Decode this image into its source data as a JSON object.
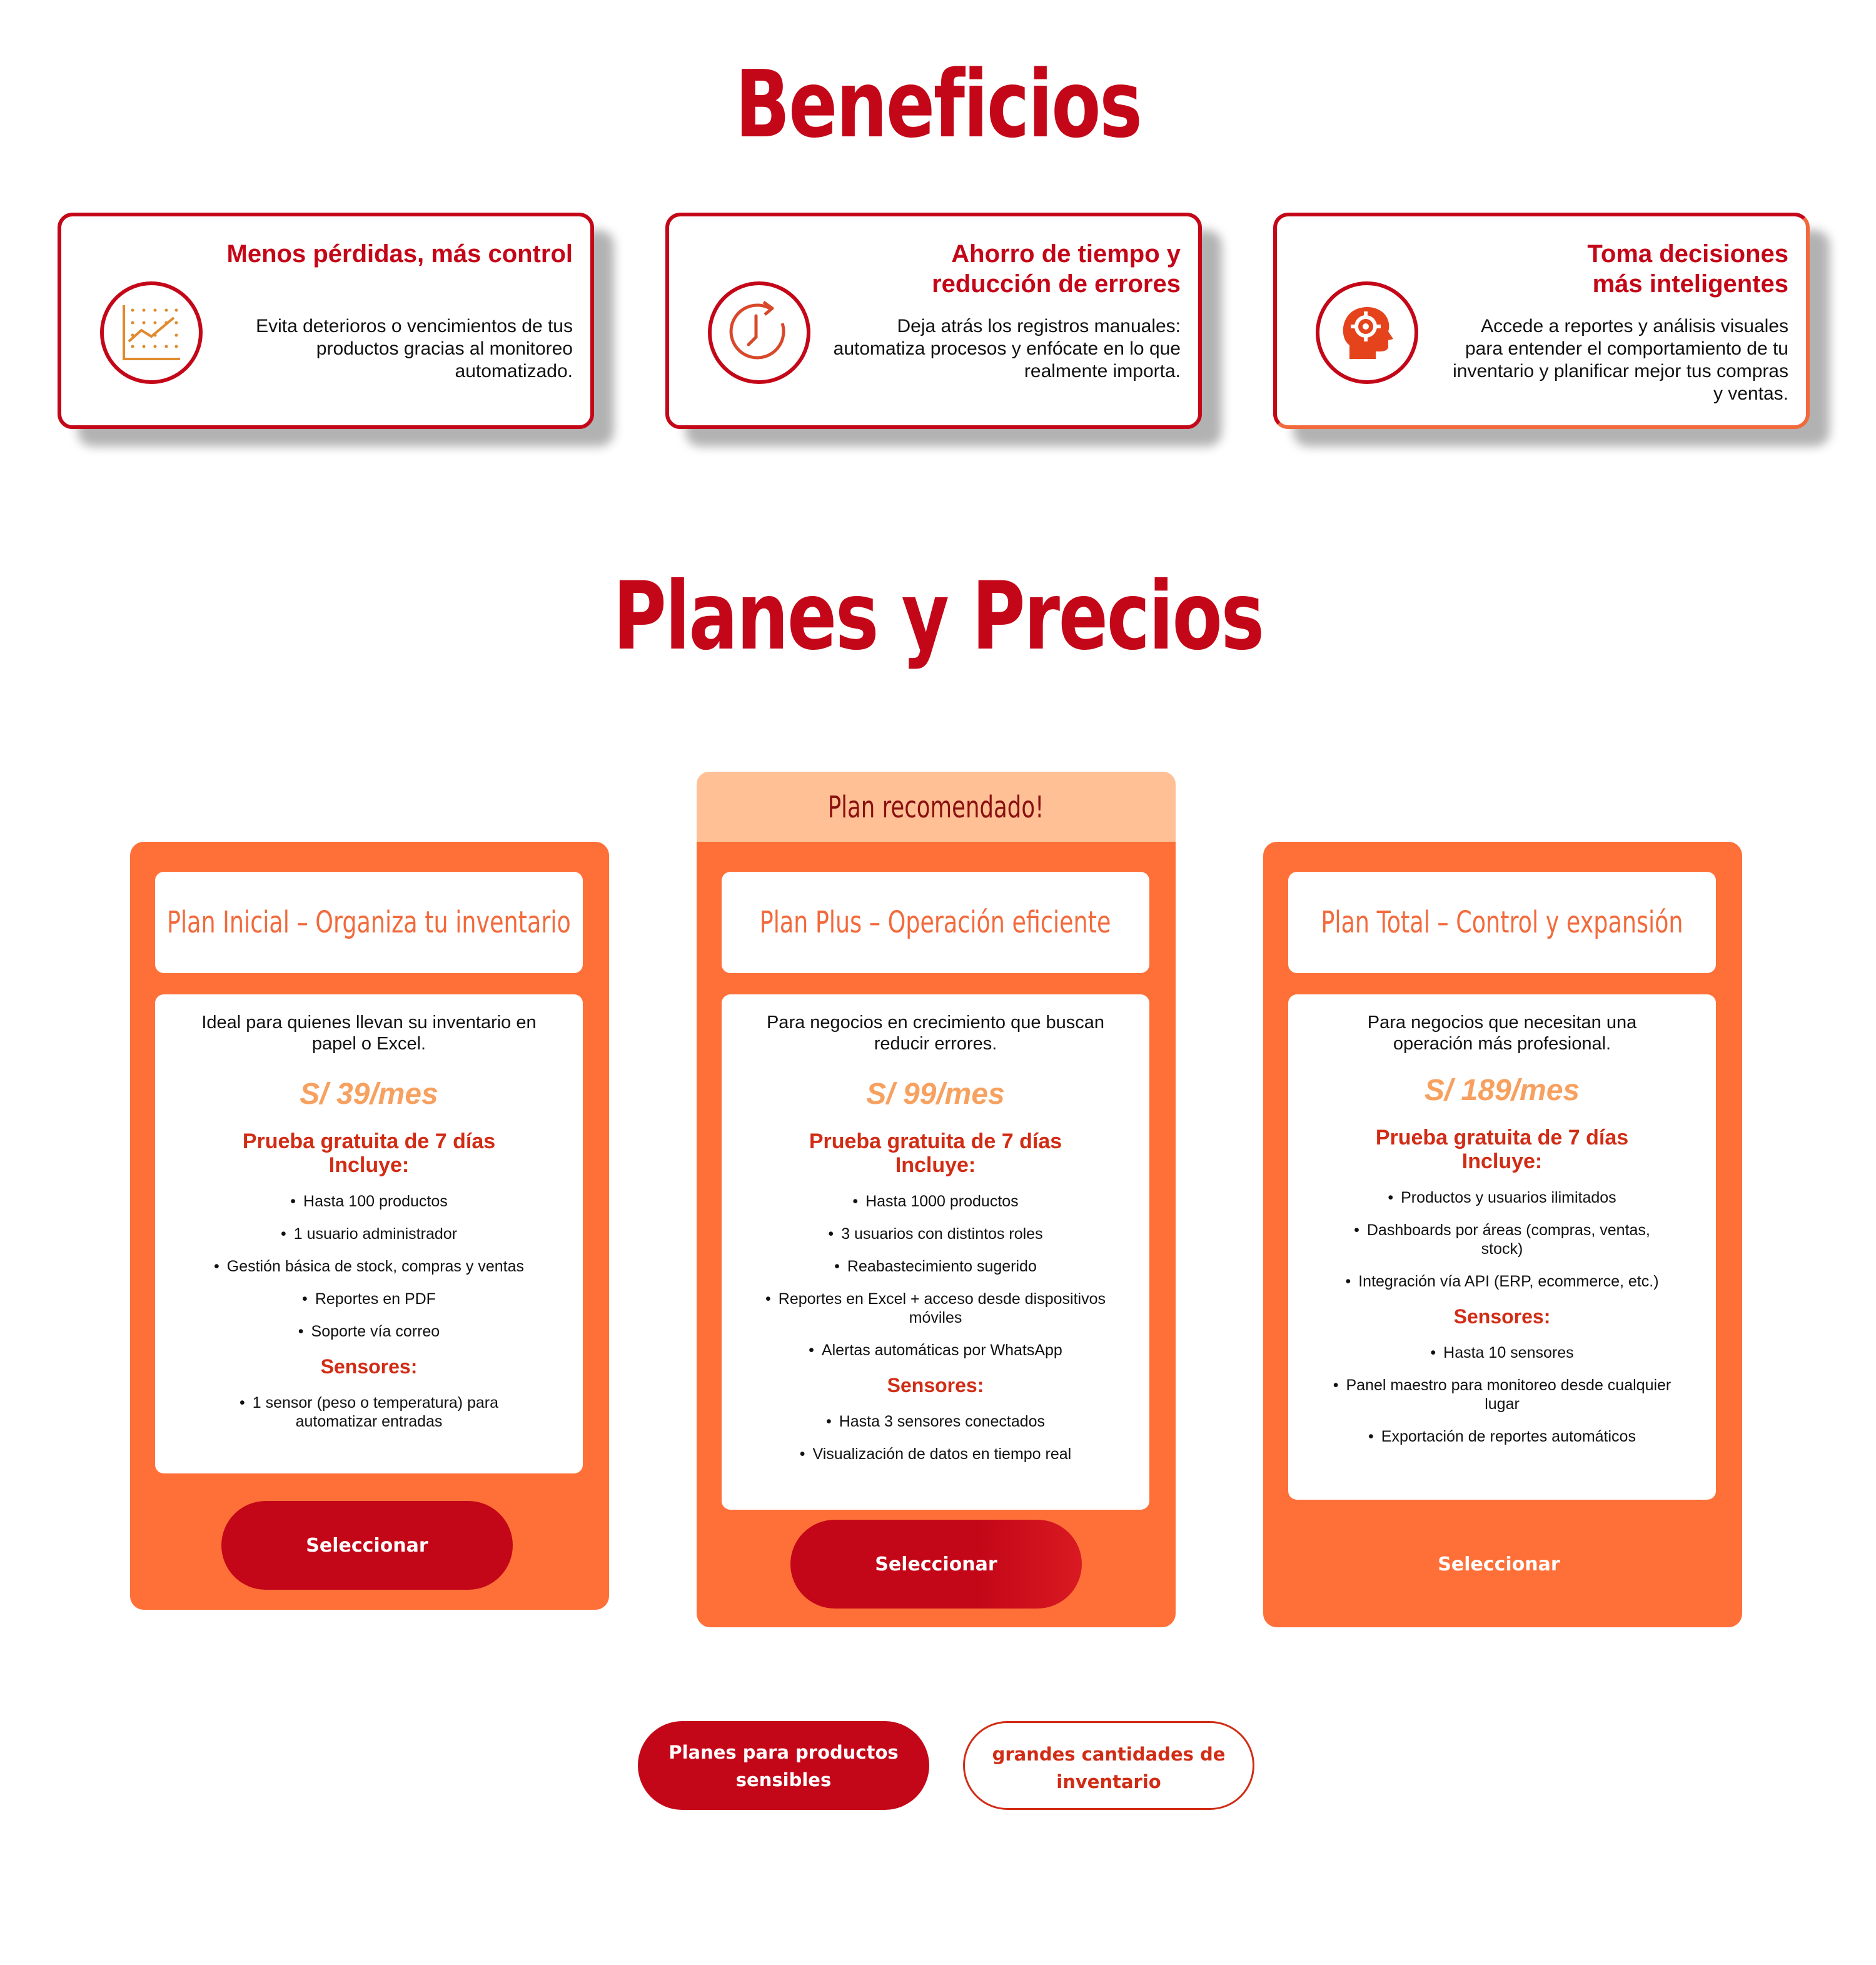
{
  "beneficios": {
    "title": "Beneficios",
    "items": [
      {
        "title": "Menos pérdidas, más control",
        "description": "Evita deterioros o vencimientos de tus productos gracias al monitoreo automatizado.",
        "icon": "chart-growth-icon"
      },
      {
        "title": "Ahorro de tiempo y\nreducción de errores",
        "description": "Deja atrás los registros manuales: automatiza procesos y enfócate en lo que realmente importa.",
        "icon": "clock-icon"
      },
      {
        "title": "Toma decisiones\nmás inteligentes",
        "description": "Accede a reportes y análisis visuales para entender el comportamiento de tu inventario y planificar mejor tus compras y ventas.",
        "icon": "head-gear-icon"
      }
    ]
  },
  "planes": {
    "title": "Planes y Precios",
    "recommended_label": "Plan recomendado!",
    "plans": [
      {
        "name": "Plan Inicial – Organiza tu inventario",
        "intro": "Ideal para quienes llevan su inventario en papel o Excel.",
        "price": "S/ 39/mes",
        "trial": "Prueba gratuita de 7 días",
        "includes_label": "Incluye:",
        "features": [
          "Hasta 100 productos",
          "1 usuario administrador",
          "Gestión básica de stock, compras y ventas",
          "Reportes en PDF",
          "Soporte vía correo"
        ],
        "sensors_label": "Sensores:",
        "sensors": [
          "1 sensor (peso o temperatura) para automatizar entradas"
        ],
        "button": "Seleccionar"
      },
      {
        "name": "Plan Plus – Operación eficiente",
        "intro": "Para negocios en crecimiento que buscan reducir errores.",
        "price": "S/ 99/mes",
        "trial": "Prueba gratuita de 7 días",
        "includes_label": "Incluye:",
        "features": [
          "Hasta 1000 productos",
          "3 usuarios con distintos roles",
          "Reabastecimiento sugerido",
          "Reportes en Excel + acceso desde dispositivos móviles",
          "Alertas automáticas por WhatsApp"
        ],
        "sensors_label": "Sensores:",
        "sensors": [
          "Hasta 3 sensores conectados",
          "Visualización de datos en tiempo real"
        ],
        "button": "Seleccionar"
      },
      {
        "name": "Plan Total – Control y expansión",
        "intro": "Para negocios que necesitan una operación más profesional.",
        "price": "S/ 189/mes",
        "trial": "Prueba gratuita de 7 días",
        "includes_label": "Incluye:",
        "features": [
          "Productos y usuarios ilimitados",
          "Dashboards por áreas (compras, ventas, stock)",
          "Integración vía API (ERP, ecommerce, etc.)"
        ],
        "sensors_label": "Sensores:",
        "sensors": [
          "Hasta 10 sensores",
          "Panel maestro para monitoreo desde cualquier lugar",
          "Exportación de reportes automáticos"
        ],
        "button": "Seleccionar"
      }
    ]
  },
  "bottom_buttons": {
    "primary": "Planes para productos sensibles",
    "secondary": "grandes cantidades de inventario"
  },
  "colors": {
    "brand_red": "#c40718",
    "plan_orange": "#ff7039",
    "recommended_peach": "#ffc095",
    "price_orange": "#f7a160",
    "accent_red": "#d12c15"
  }
}
